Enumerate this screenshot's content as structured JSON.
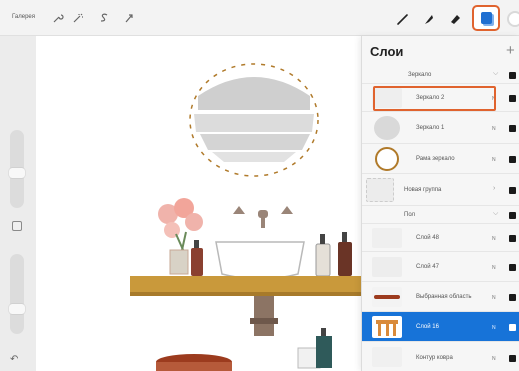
{
  "toolbar": {
    "gallery_label": "Галерея",
    "left_tools": [
      "wrench-icon",
      "magic-wand-icon",
      "s-selection-icon",
      "arrow-icon"
    ],
    "right_tools": [
      "brush-icon",
      "smudge-icon",
      "eraser-icon"
    ],
    "layers_icon": "layers-icon",
    "color_swatch": "#ffffff",
    "accent": "#e0632e"
  },
  "sidebar": {
    "undo_icon": "undo-icon"
  },
  "layers_panel": {
    "title": "Слои",
    "add_icon": "plus-icon",
    "add_label": "+",
    "groups": {
      "mirror": {
        "label": "Зеркало",
        "expanded": true
      },
      "floor": {
        "label": "Пол",
        "expanded": true
      }
    },
    "layers": [
      {
        "name": "Зеркало 2",
        "mode": "N",
        "visible": true,
        "highlighted": true
      },
      {
        "name": "Зеркало 1",
        "mode": "N",
        "visible": true
      },
      {
        "name": "Рама зеркало",
        "mode": "N",
        "visible": true
      },
      {
        "name": "Новая группа",
        "mode": "",
        "visible": true,
        "group": true
      },
      {
        "name": "Слой 48",
        "mode": "N",
        "visible": true
      },
      {
        "name": "Слой 47",
        "mode": "N",
        "visible": true
      },
      {
        "name": "Выбранная область",
        "mode": "N",
        "visible": true
      },
      {
        "name": "Слой 16",
        "mode": "N",
        "visible": true,
        "selected": true
      },
      {
        "name": "Контур ковра",
        "mode": "N",
        "visible": true
      }
    ],
    "selected_color": "#1773d8"
  }
}
